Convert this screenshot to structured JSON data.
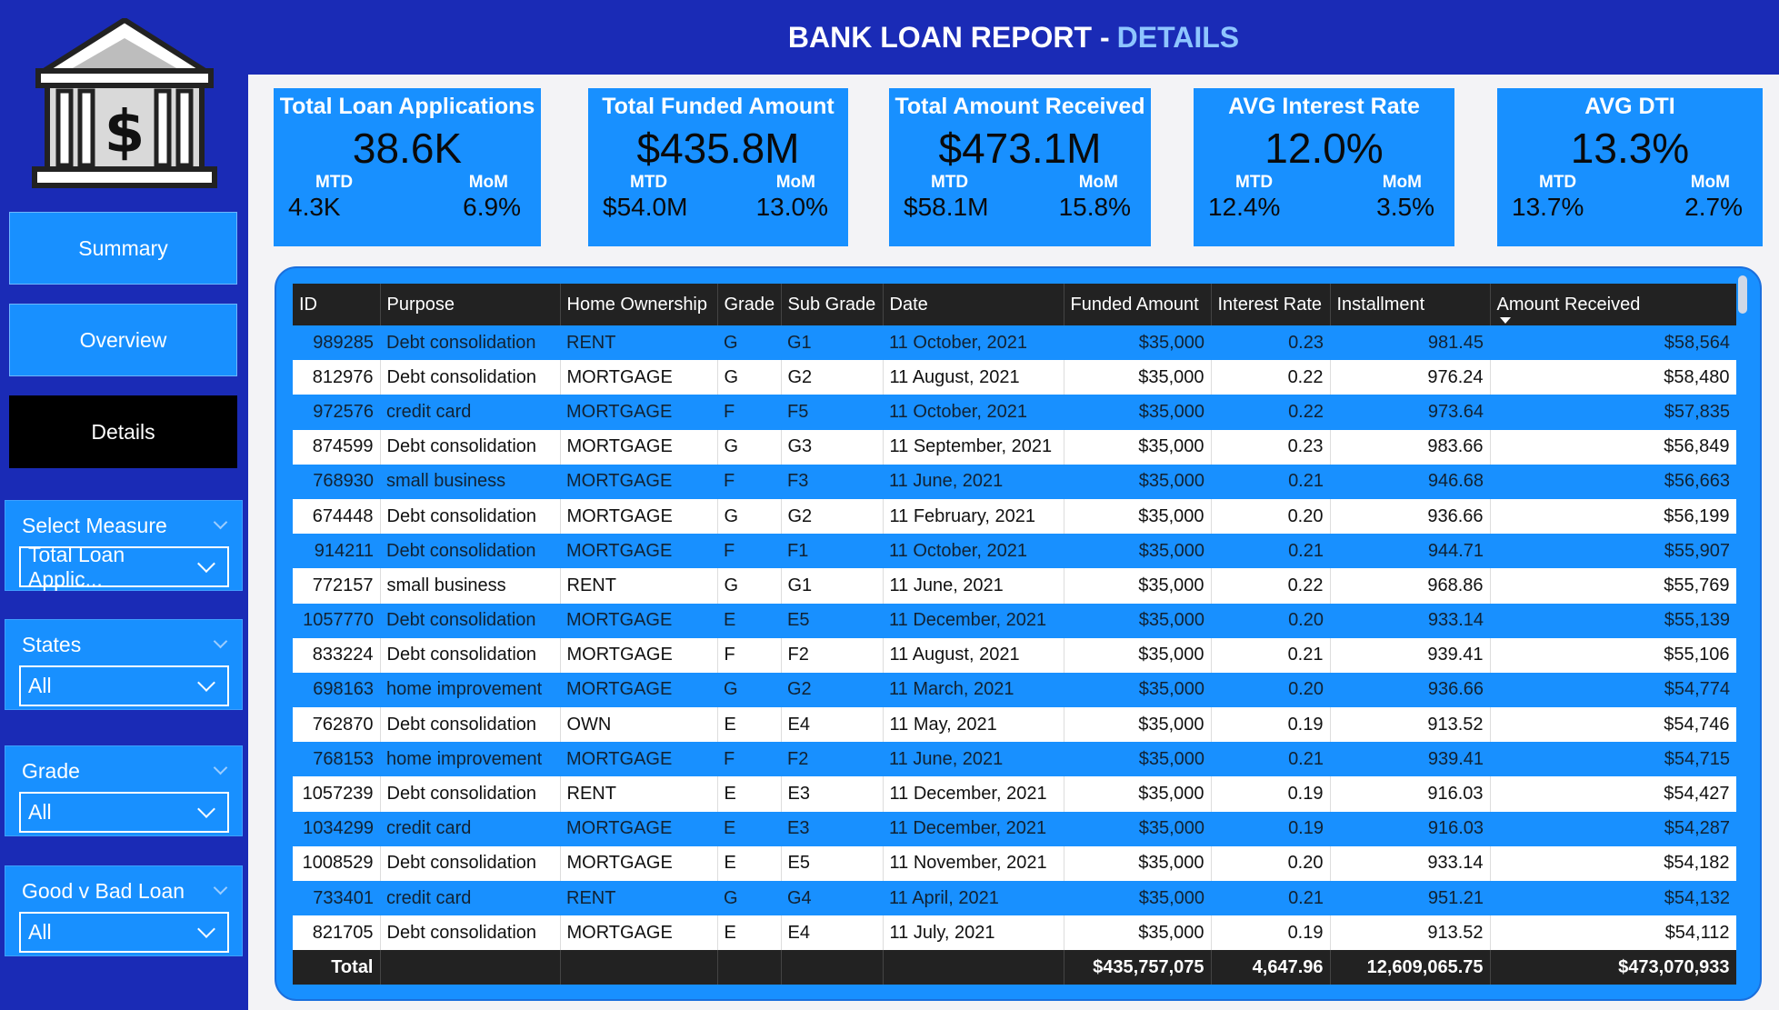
{
  "header": {
    "title": "BANK LOAN REPORT -",
    "subtitle": "DETAILS"
  },
  "nav": {
    "summary": "Summary",
    "overview": "Overview",
    "details": "Details"
  },
  "slicers": [
    {
      "label": "Select Measure",
      "value": "Total Loan Applic..."
    },
    {
      "label": "States",
      "value": "All"
    },
    {
      "label": "Grade",
      "value": "All"
    },
    {
      "label": "Good v Bad Loan",
      "value": "All"
    }
  ],
  "kpis": [
    {
      "title": "Total Loan Applications",
      "value": "38.6K",
      "mtd_label": "MTD",
      "mom_label": "MoM",
      "mtd": "4.3K",
      "mom": "6.9%"
    },
    {
      "title": "Total Funded Amount",
      "value": "$435.8M",
      "mtd_label": "MTD",
      "mom_label": "MoM",
      "mtd": "$54.0M",
      "mom": "13.0%"
    },
    {
      "title": "Total Amount Received",
      "value": "$473.1M",
      "mtd_label": "MTD",
      "mom_label": "MoM",
      "mtd": "$58.1M",
      "mom": "15.8%"
    },
    {
      "title": "AVG Interest Rate",
      "value": "12.0%",
      "mtd_label": "MTD",
      "mom_label": "MoM",
      "mtd": "12.4%",
      "mom": "3.5%"
    },
    {
      "title": "AVG DTI",
      "value": "13.3%",
      "mtd_label": "MTD",
      "mom_label": "MoM",
      "mtd": "13.7%",
      "mom": "2.7%"
    }
  ],
  "table": {
    "columns": [
      "ID",
      "Purpose",
      "Home Ownership",
      "Grade",
      "Sub Grade",
      "Date",
      "Funded Amount",
      "Interest Rate",
      "Installment",
      "Amount Received"
    ],
    "rows": [
      [
        "989285",
        "Debt consolidation",
        "RENT",
        "G",
        "G1",
        "11 October, 2021",
        "$35,000",
        "0.23",
        "981.45",
        "$58,564"
      ],
      [
        "812976",
        "Debt consolidation",
        "MORTGAGE",
        "G",
        "G2",
        "11 August, 2021",
        "$35,000",
        "0.22",
        "976.24",
        "$58,480"
      ],
      [
        "972576",
        "credit card",
        "MORTGAGE",
        "F",
        "F5",
        "11 October, 2021",
        "$35,000",
        "0.22",
        "973.64",
        "$57,835"
      ],
      [
        "874599",
        "Debt consolidation",
        "MORTGAGE",
        "G",
        "G3",
        "11 September, 2021",
        "$35,000",
        "0.23",
        "983.66",
        "$56,849"
      ],
      [
        "768930",
        "small business",
        "MORTGAGE",
        "F",
        "F3",
        "11 June, 2021",
        "$35,000",
        "0.21",
        "946.68",
        "$56,663"
      ],
      [
        "674448",
        "Debt consolidation",
        "MORTGAGE",
        "G",
        "G2",
        "11 February, 2021",
        "$35,000",
        "0.20",
        "936.66",
        "$56,199"
      ],
      [
        "914211",
        "Debt consolidation",
        "MORTGAGE",
        "F",
        "F1",
        "11 October, 2021",
        "$35,000",
        "0.21",
        "944.71",
        "$55,907"
      ],
      [
        "772157",
        "small business",
        "RENT",
        "G",
        "G1",
        "11 June, 2021",
        "$35,000",
        "0.22",
        "968.86",
        "$55,769"
      ],
      [
        "1057770",
        "Debt consolidation",
        "MORTGAGE",
        "E",
        "E5",
        "11 December, 2021",
        "$35,000",
        "0.20",
        "933.14",
        "$55,139"
      ],
      [
        "833224",
        "Debt consolidation",
        "MORTGAGE",
        "F",
        "F2",
        "11 August, 2021",
        "$35,000",
        "0.21",
        "939.41",
        "$55,106"
      ],
      [
        "698163",
        "home improvement",
        "MORTGAGE",
        "G",
        "G2",
        "11 March, 2021",
        "$35,000",
        "0.20",
        "936.66",
        "$54,774"
      ],
      [
        "762870",
        "Debt consolidation",
        "OWN",
        "E",
        "E4",
        "11 May, 2021",
        "$35,000",
        "0.19",
        "913.52",
        "$54,746"
      ],
      [
        "768153",
        "home improvement",
        "MORTGAGE",
        "F",
        "F2",
        "11 June, 2021",
        "$35,000",
        "0.21",
        "939.41",
        "$54,715"
      ],
      [
        "1057239",
        "Debt consolidation",
        "RENT",
        "E",
        "E3",
        "11 December, 2021",
        "$35,000",
        "0.19",
        "916.03",
        "$54,427"
      ],
      [
        "1034299",
        "credit card",
        "MORTGAGE",
        "E",
        "E3",
        "11 December, 2021",
        "$35,000",
        "0.19",
        "916.03",
        "$54,287"
      ],
      [
        "1008529",
        "Debt consolidation",
        "MORTGAGE",
        "E",
        "E5",
        "11 November, 2021",
        "$35,000",
        "0.20",
        "933.14",
        "$54,182"
      ],
      [
        "733401",
        "credit card",
        "RENT",
        "G",
        "G4",
        "11 April, 2021",
        "$35,000",
        "0.21",
        "951.21",
        "$54,132"
      ],
      [
        "821705",
        "Debt consolidation",
        "MORTGAGE",
        "E",
        "E4",
        "11 July, 2021",
        "$35,000",
        "0.19",
        "913.52",
        "$54,112"
      ]
    ],
    "total": [
      "Total",
      "",
      "",
      "",
      "",
      "",
      "$435,757,075",
      "4,647.96",
      "12,609,065.75",
      "$473,070,933"
    ]
  },
  "colors": {
    "primary": "#1890ff",
    "navy": "#1a2bb6",
    "dark": "#222222"
  },
  "icons": {
    "logo": "bank-icon"
  }
}
